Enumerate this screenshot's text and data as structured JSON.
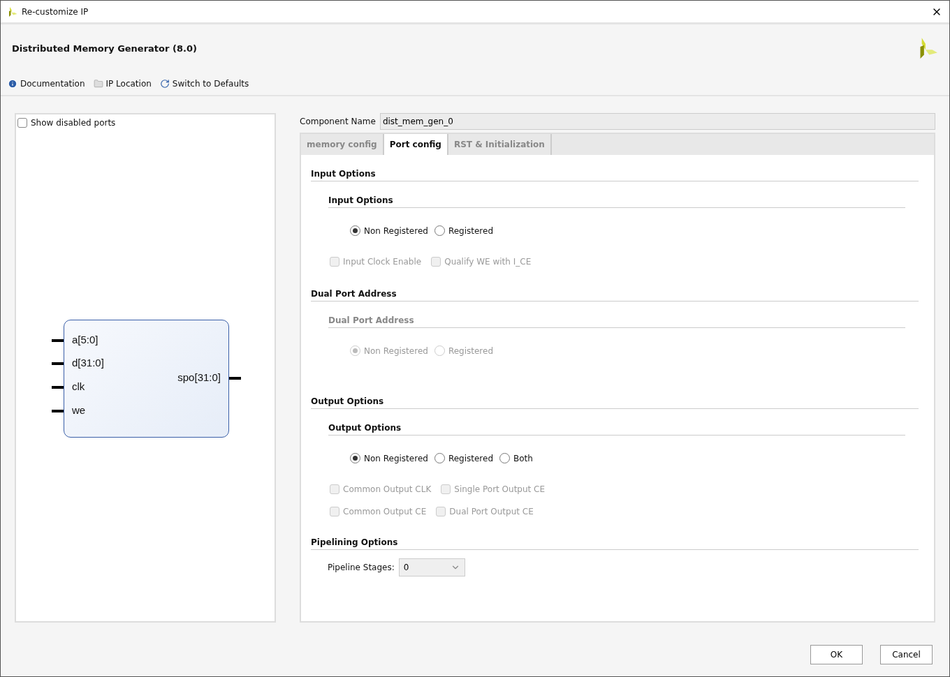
{
  "window": {
    "title": "Re-customize IP"
  },
  "header": {
    "title": "Distributed Memory Generator (8.0)"
  },
  "toolbar": [
    {
      "kind": "info",
      "label": "Documentation"
    },
    {
      "kind": "folder",
      "label": "IP Location"
    },
    {
      "kind": "refresh",
      "label": "Switch to Defaults"
    }
  ],
  "symbol_panel": {
    "show_disabled_ports": {
      "label": "Show disabled ports",
      "checked": false
    },
    "block": {
      "inputs": [
        "a[5:0]",
        "d[31:0]",
        "clk",
        "we"
      ],
      "outputs": [
        "spo[31:0]"
      ]
    }
  },
  "component_name": {
    "label": "Component Name",
    "value": "dist_mem_gen_0"
  },
  "tabs": [
    {
      "label": "memory config",
      "selected": false
    },
    {
      "label": "Port config",
      "selected": true
    },
    {
      "label": "RST & Initialization",
      "selected": false
    }
  ],
  "sections": [
    {
      "title": "Input Options",
      "group": {
        "title": "Input Options",
        "disabled": false,
        "options": [
          {
            "label": "Non Registered",
            "selected": true
          },
          {
            "label": "Registered",
            "selected": false
          }
        ]
      },
      "checkbox_rows": [
        [
          {
            "label": "Input Clock Enable",
            "checked": false,
            "disabled": true
          },
          {
            "label": "Qualify WE with I_CE",
            "checked": false,
            "disabled": true
          }
        ]
      ]
    },
    {
      "title": "Dual Port Address",
      "group": {
        "title": "Dual Port Address",
        "disabled": true,
        "options": [
          {
            "label": "Non Registered",
            "selected": true
          },
          {
            "label": "Registered",
            "selected": false
          }
        ]
      }
    },
    {
      "title": "Output Options",
      "group": {
        "title": "Output Options",
        "disabled": false,
        "options": [
          {
            "label": "Non Registered",
            "selected": true
          },
          {
            "label": "Registered",
            "selected": false
          },
          {
            "label": "Both",
            "selected": false
          }
        ]
      },
      "checkbox_rows": [
        [
          {
            "label": "Common Output CLK",
            "checked": false,
            "disabled": true
          },
          {
            "label": "Single Port Output CE",
            "checked": false,
            "disabled": true
          }
        ],
        [
          {
            "label": "Common Output CE",
            "checked": false,
            "disabled": true
          },
          {
            "label": "Dual Port Output CE",
            "checked": false,
            "disabled": true
          }
        ]
      ]
    }
  ],
  "pipelining": {
    "title": "Pipelining Options",
    "label": "Pipeline Stages:",
    "value": "0"
  },
  "buttons": [
    "OK",
    "Cancel"
  ]
}
